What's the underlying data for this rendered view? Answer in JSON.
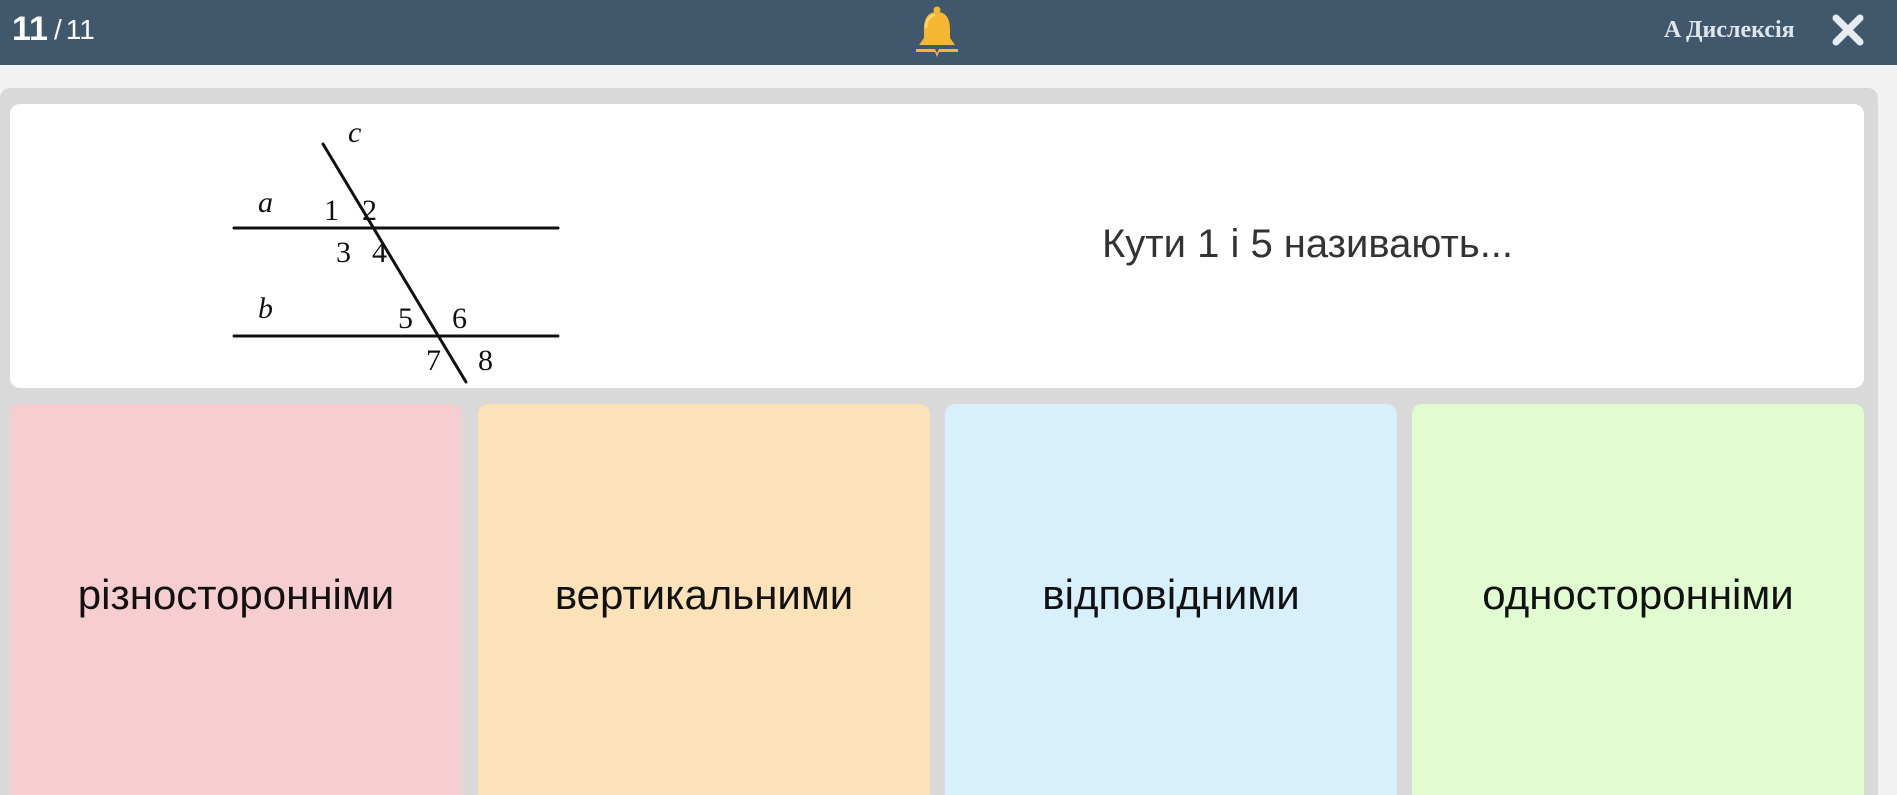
{
  "header": {
    "current_question": "11",
    "separator": "/",
    "total_questions": "11",
    "center_icon": "bell-icon",
    "dyslexia_label": "A Дислексія",
    "close_icon": "close-icon"
  },
  "question": {
    "text": "Кути 1 і 5 називають...",
    "figure": {
      "line_labels": {
        "a": "a",
        "b": "b",
        "c": "c"
      },
      "angle_labels": [
        "1",
        "2",
        "3",
        "4",
        "5",
        "6",
        "7",
        "8"
      ]
    }
  },
  "answers": [
    {
      "label": "різносторонніми",
      "color": "#f6cdd0"
    },
    {
      "label": "вертикальними",
      "color": "#fbe2b8"
    },
    {
      "label": "відповідними",
      "color": "#d8f0fb"
    },
    {
      "label": "односторонніми",
      "color": "#e0fcd0"
    }
  ],
  "colors": {
    "topbar": "#41576c",
    "bell": "#f5b731",
    "board": "#d9d9d9"
  }
}
